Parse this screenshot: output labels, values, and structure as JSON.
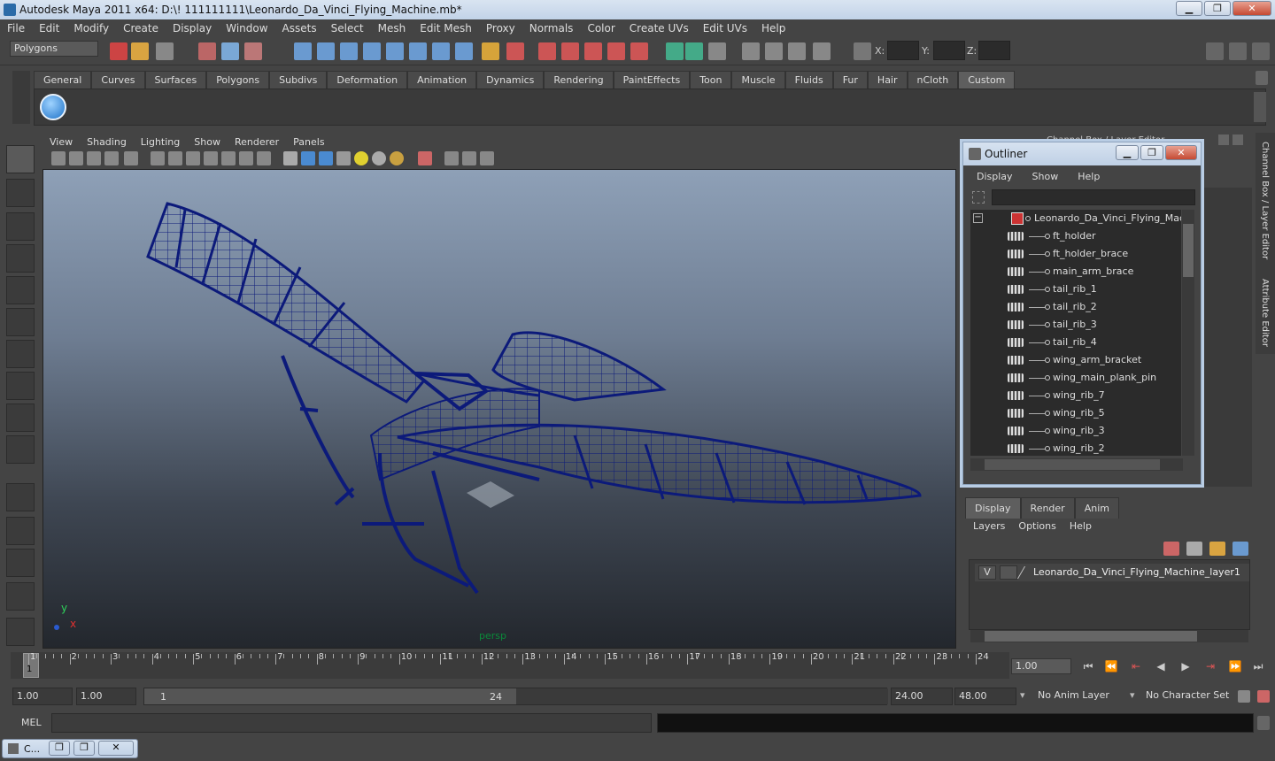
{
  "window": {
    "title": "Autodesk Maya 2011 x64: D:\\! 111111111\\Leonardo_Da_Vinci_Flying_Machine.mb*",
    "min": "▁",
    "max": "❐",
    "close": "✕"
  },
  "menubar": [
    "File",
    "Edit",
    "Modify",
    "Create",
    "Display",
    "Window",
    "Assets",
    "Select",
    "Mesh",
    "Edit Mesh",
    "Proxy",
    "Normals",
    "Color",
    "Create UVs",
    "Edit UVs",
    "Help"
  ],
  "statusline": {
    "mode": "Polygons",
    "x_label": "X:",
    "y_label": "Y:",
    "z_label": "Z:"
  },
  "shelf": {
    "tabs": [
      "General",
      "Curves",
      "Surfaces",
      "Polygons",
      "Subdivs",
      "Deformation",
      "Animation",
      "Dynamics",
      "Rendering",
      "PaintEffects",
      "Toon",
      "Muscle",
      "Fluids",
      "Fur",
      "Hair",
      "nCloth",
      "Custom"
    ],
    "active_tab": "Custom"
  },
  "panel": {
    "menu": [
      "View",
      "Shading",
      "Lighting",
      "Show",
      "Renderer",
      "Panels"
    ],
    "camera_label": "persp",
    "axis_y": "y",
    "axis_x": "x"
  },
  "channel_box": {
    "title": "Channel Box / Layer Editor",
    "side_tab_1": "Channel Box / Layer Editor",
    "side_tab_2": "Attribute Editor"
  },
  "outliner": {
    "title": "Outliner",
    "menu": [
      "Display",
      "Show",
      "Help"
    ],
    "root": "Leonardo_Da_Vinci_Flying_Machin",
    "items": [
      "ft_holder",
      "ft_holder_brace",
      "main_arm_brace",
      "tail_rib_1",
      "tail_rib_2",
      "tail_rib_3",
      "tail_rib_4",
      "wing_arm_bracket",
      "wing_main_plank_pin",
      "wing_rib_7",
      "wing_rib_5",
      "wing_rib_3",
      "wing_rib_2"
    ],
    "collapse": "−"
  },
  "layer_editor": {
    "tabs": [
      "Display",
      "Render",
      "Anim"
    ],
    "active_tab": "Display",
    "menu": [
      "Layers",
      "Options",
      "Help"
    ],
    "layer": {
      "visible": "V",
      "name": "Leonardo_Da_Vinci_Flying_Machine_layer1"
    }
  },
  "timeline": {
    "ticks": [
      "1",
      "2",
      "3",
      "4",
      "5",
      "6",
      "7",
      "8",
      "9",
      "10",
      "11",
      "12",
      "13",
      "14",
      "15",
      "16",
      "17",
      "18",
      "19",
      "20",
      "21",
      "22",
      "23",
      "24"
    ],
    "current_frame": "1",
    "current_time": "1.00"
  },
  "range": {
    "start": "1.00",
    "playback_start": "1.00",
    "slider_start": "1",
    "slider_end": "24",
    "playback_end": "24.00",
    "end": "48.00",
    "anim_layer": "No Anim Layer",
    "character_set": "No Character Set"
  },
  "command": {
    "label": "MEL"
  },
  "taskbar": {
    "window_label": "C..."
  },
  "colors": {
    "viewport_top": "#8ea0b7",
    "viewport_bottom": "#23272d",
    "wireframe": "#0c1a7a",
    "accent": "#1d72c8"
  }
}
